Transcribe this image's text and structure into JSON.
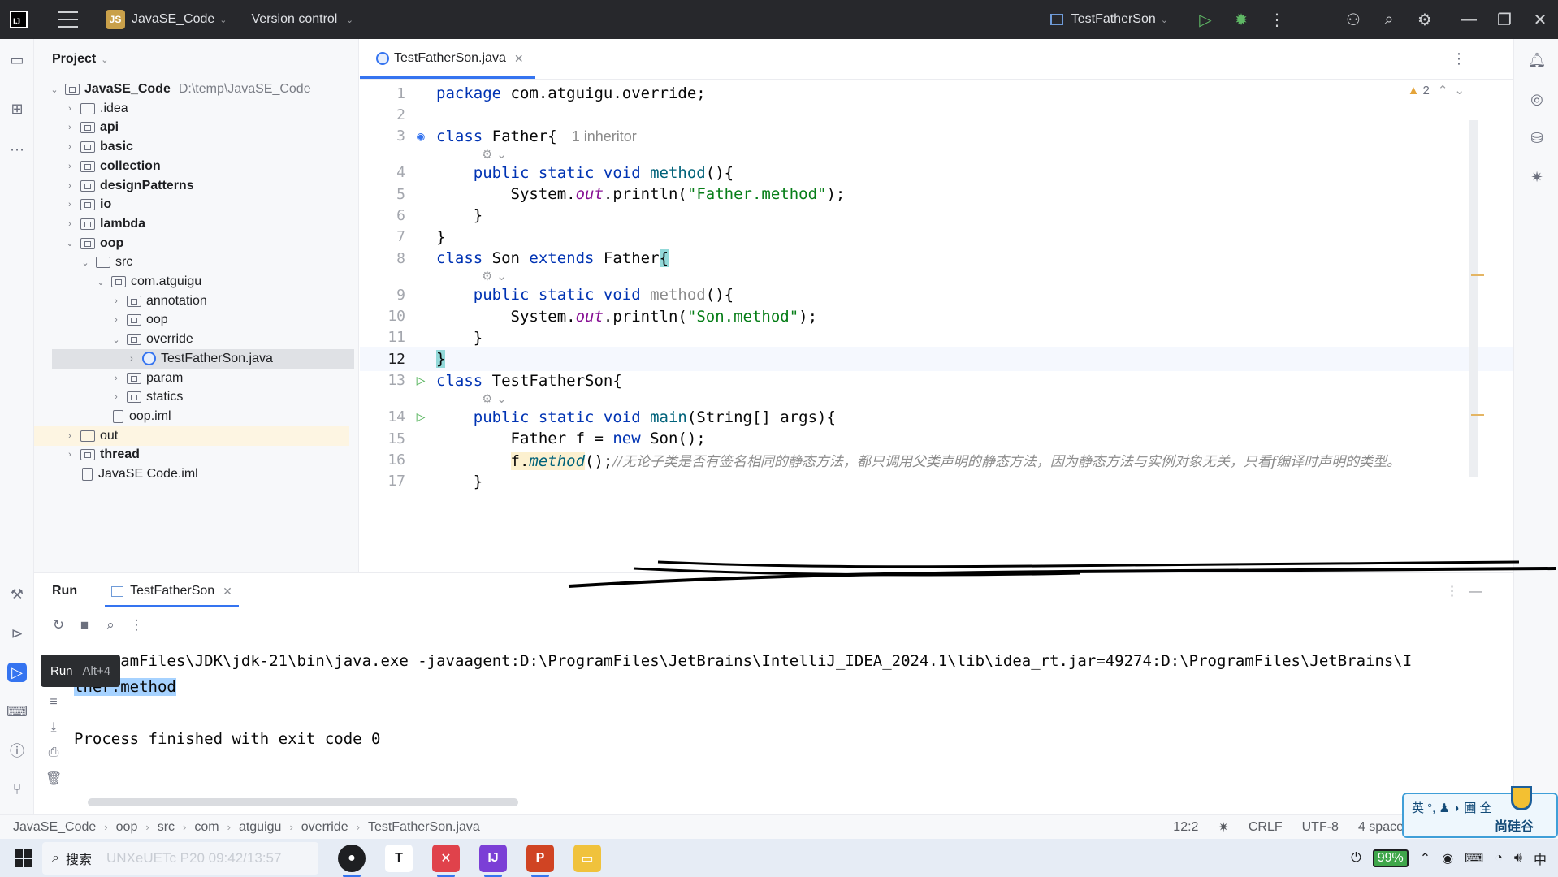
{
  "titlebar": {
    "project_badge": "JS",
    "project_name": "JavaSE_Code",
    "version_control": "Version control",
    "run_config": "TestFatherSon"
  },
  "project_pane": {
    "title": "Project",
    "tree": [
      {
        "label": "JavaSE_Code",
        "extra": "D:\\temp\\JavaSE_Code",
        "level": 0,
        "expanded": true,
        "kind": "module",
        "bold": true
      },
      {
        "label": ".idea",
        "level": 1,
        "expanded": false,
        "kind": "folder",
        "bold": false
      },
      {
        "label": "api",
        "level": 1,
        "expanded": false,
        "kind": "module",
        "bold": true
      },
      {
        "label": "basic",
        "level": 1,
        "expanded": false,
        "kind": "module",
        "bold": true
      },
      {
        "label": "collection",
        "level": 1,
        "expanded": false,
        "kind": "module",
        "bold": true
      },
      {
        "label": "designPatterns",
        "level": 1,
        "expanded": false,
        "kind": "module",
        "bold": true
      },
      {
        "label": "io",
        "level": 1,
        "expanded": false,
        "kind": "module",
        "bold": true
      },
      {
        "label": "lambda",
        "level": 1,
        "expanded": false,
        "kind": "module",
        "bold": true
      },
      {
        "label": "oop",
        "level": 1,
        "expanded": true,
        "kind": "module",
        "bold": true
      },
      {
        "label": "src",
        "level": 2,
        "expanded": true,
        "kind": "folder",
        "bold": false
      },
      {
        "label": "com.atguigu",
        "level": 3,
        "expanded": true,
        "kind": "package",
        "bold": false
      },
      {
        "label": "annotation",
        "level": 4,
        "expanded": false,
        "kind": "package",
        "bold": false
      },
      {
        "label": "oop",
        "level": 4,
        "expanded": false,
        "kind": "package",
        "bold": false
      },
      {
        "label": "override",
        "level": 4,
        "expanded": true,
        "kind": "package",
        "bold": false
      },
      {
        "label": "TestFatherSon.java",
        "level": 5,
        "expanded": false,
        "kind": "class",
        "bold": false,
        "selected": true
      },
      {
        "label": "param",
        "level": 4,
        "expanded": false,
        "kind": "package",
        "bold": false
      },
      {
        "label": "statics",
        "level": 4,
        "expanded": false,
        "kind": "package",
        "bold": false
      },
      {
        "label": "oop.iml",
        "level": 3,
        "expanded": null,
        "kind": "file",
        "bold": false
      },
      {
        "label": "out",
        "level": 1,
        "expanded": false,
        "kind": "folder",
        "bold": false,
        "highlight": true
      },
      {
        "label": "thread",
        "level": 1,
        "expanded": false,
        "kind": "module",
        "bold": true
      },
      {
        "label": "JavaSE Code.iml",
        "level": 1,
        "expanded": null,
        "kind": "file",
        "bold": false
      }
    ]
  },
  "editor": {
    "tab": "TestFatherSon.java",
    "warnings": "2",
    "current_line": 12,
    "lines": [
      {
        "n": "1",
        "gutter": "",
        "hint": false,
        "parts": [
          [
            "kw",
            "package "
          ],
          [
            "",
            "com.atguigu.override;"
          ]
        ]
      },
      {
        "n": "2",
        "gutter": "",
        "hint": false,
        "parts": []
      },
      {
        "n": "3",
        "gutter": "override",
        "hint": true,
        "parts": [
          [
            "kw",
            "class "
          ],
          [
            "",
            "Father{"
          ],
          [
            "inherit",
            "1 inheritor"
          ]
        ]
      },
      {
        "n": "4",
        "gutter": "",
        "hint": false,
        "parts": [
          [
            "",
            "    "
          ],
          [
            "kw",
            "public static void "
          ],
          [
            "meth",
            "method"
          ],
          [
            "",
            "(){"
          ]
        ]
      },
      {
        "n": "5",
        "gutter": "",
        "hint": false,
        "parts": [
          [
            "",
            "        System."
          ],
          [
            "stat",
            "out"
          ],
          [
            "",
            ".println("
          ],
          [
            "str",
            "\"Father.method\""
          ],
          [
            "",
            ");"
          ]
        ]
      },
      {
        "n": "6",
        "gutter": "",
        "hint": false,
        "parts": [
          [
            "",
            "    }"
          ]
        ]
      },
      {
        "n": "7",
        "gutter": "",
        "hint": false,
        "parts": [
          [
            "",
            "}"
          ]
        ]
      },
      {
        "n": "8",
        "gutter": "",
        "hint": true,
        "parts": [
          [
            "kw",
            "class "
          ],
          [
            "",
            "Son "
          ],
          [
            "kw",
            "extends "
          ],
          [
            "",
            "Father"
          ],
          [
            "brace-hl",
            "{"
          ]
        ]
      },
      {
        "n": "9",
        "gutter": "",
        "hint": false,
        "parts": [
          [
            "",
            "    "
          ],
          [
            "kw",
            "public static void "
          ],
          [
            "grey",
            "method"
          ],
          [
            "",
            "(){"
          ]
        ]
      },
      {
        "n": "10",
        "gutter": "",
        "hint": false,
        "parts": [
          [
            "",
            "        System."
          ],
          [
            "stat",
            "out"
          ],
          [
            "",
            ".println("
          ],
          [
            "str",
            "\"Son.method\""
          ],
          [
            "",
            ");"
          ]
        ]
      },
      {
        "n": "11",
        "gutter": "",
        "hint": false,
        "parts": [
          [
            "",
            "    }"
          ]
        ]
      },
      {
        "n": "12",
        "gutter": "",
        "hint": false,
        "parts": [
          [
            "brace-hl",
            "}"
          ]
        ]
      },
      {
        "n": "13",
        "gutter": "run",
        "hint": true,
        "parts": [
          [
            "kw",
            "class "
          ],
          [
            "",
            "TestFatherSon{"
          ]
        ]
      },
      {
        "n": "14",
        "gutter": "run",
        "hint": false,
        "parts": [
          [
            "",
            "    "
          ],
          [
            "kw",
            "public static void "
          ],
          [
            "meth",
            "main"
          ],
          [
            "",
            "(String[] args){"
          ]
        ]
      },
      {
        "n": "15",
        "gutter": "",
        "hint": false,
        "parts": [
          [
            "",
            "        Father f = "
          ],
          [
            "kw",
            "new "
          ],
          [
            "",
            "Son();"
          ]
        ]
      },
      {
        "n": "16",
        "gutter": "",
        "hint": false,
        "parts": [
          [
            "",
            "        "
          ],
          [
            "warnbg",
            "f."
          ],
          [
            "warnital",
            "method"
          ],
          [
            "",
            "();"
          ],
          [
            "cmt",
            "//无论子类是否有签名相同的静态方法，都只调用父类声明的静态方法，因为静态方法与实例对象无关，只看f编译时声明的类型。"
          ]
        ]
      },
      {
        "n": "17",
        "gutter": "",
        "hint": false,
        "parts": [
          [
            "",
            "    }"
          ]
        ]
      }
    ]
  },
  "run_panel": {
    "title": "Run",
    "tab": "TestFatherSon",
    "tooltip_label": "Run",
    "tooltip_shortcut": "Alt+4",
    "console_lines": [
      "ProgramFiles\\JDK\\jdk-21\\bin\\java.exe -javaagent:D:\\ProgramFiles\\JetBrains\\IntelliJ_IDEA_2024.1\\lib\\idea_rt.jar=49274:D:\\ProgramFiles\\JetBrains\\I",
      "ther.method",
      "",
      "Process finished with exit code 0"
    ]
  },
  "statusbar": {
    "crumbs": [
      "JavaSE_Code",
      "oop",
      "src",
      "com",
      "atguigu",
      "override",
      "TestFatherSon.java"
    ],
    "position": "12:2",
    "line_sep": "CRLF",
    "encoding": "UTF-8",
    "indent": "4 space"
  },
  "badge": {
    "ime": "英 °, ♟ ◗ 圃 全",
    "brand": "尚硅谷"
  },
  "taskbar": {
    "search_label": "搜索",
    "search_watermark": "UNXeUETc P20 09:42/13:57",
    "battery": "99%"
  },
  "colors": {
    "accent": "#3574f0",
    "run_green": "#5fb865",
    "titlebar": "#27282c"
  }
}
